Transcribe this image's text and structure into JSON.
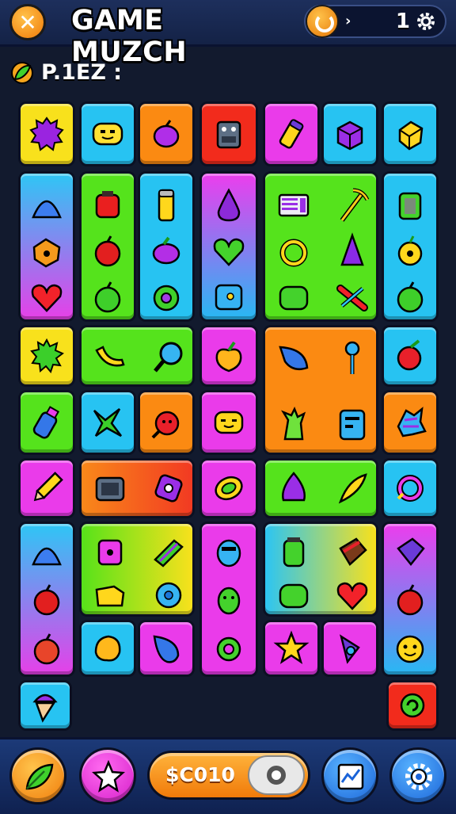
{
  "header": {
    "title": "GAME MUZCH",
    "close_icon": "close-icon",
    "counter_value": "1",
    "counter_arrow": "›",
    "accent": "#f07a08"
  },
  "piece": {
    "label": "P.1EZ :"
  },
  "board": {
    "background": "#121a2e",
    "tiles": [
      {
        "icon": "spiky-blob",
        "color": "yellow"
      },
      {
        "icon": "smiley-face",
        "color": "cyan"
      },
      {
        "icon": "plum",
        "color": "orange"
      },
      {
        "icon": "robot-box",
        "color": "red"
      },
      {
        "icon": "battery",
        "color": "pink"
      },
      {
        "icon": "purple-box",
        "color": "cyan"
      },
      {
        "icon": "yellow-box",
        "color": "cyan"
      },
      {
        "icon": "blue-dome",
        "color": "cyan-pink"
      },
      {
        "icon": "red-jar",
        "color": "green"
      },
      {
        "icon": "battery",
        "color": "cyan"
      },
      {
        "icon": "purple-drop",
        "color": "cyan-pink"
      },
      {
        "icon": "box-fridge",
        "color": "green"
      },
      {
        "icon": "pickaxe",
        "color": "green"
      },
      {
        "icon": "green-jar",
        "color": "cyan"
      },
      {
        "icon": "heart",
        "color": "pink"
      },
      {
        "icon": "star",
        "color": "pink"
      },
      {
        "icon": "apple",
        "color": "red"
      },
      {
        "icon": "leaf",
        "color": "green"
      }
    ]
  },
  "footer": {
    "coin_label": "$C010",
    "buttons": [
      "leaf-icon",
      "star-icon",
      "chart-icon",
      "gear-icon"
    ]
  }
}
